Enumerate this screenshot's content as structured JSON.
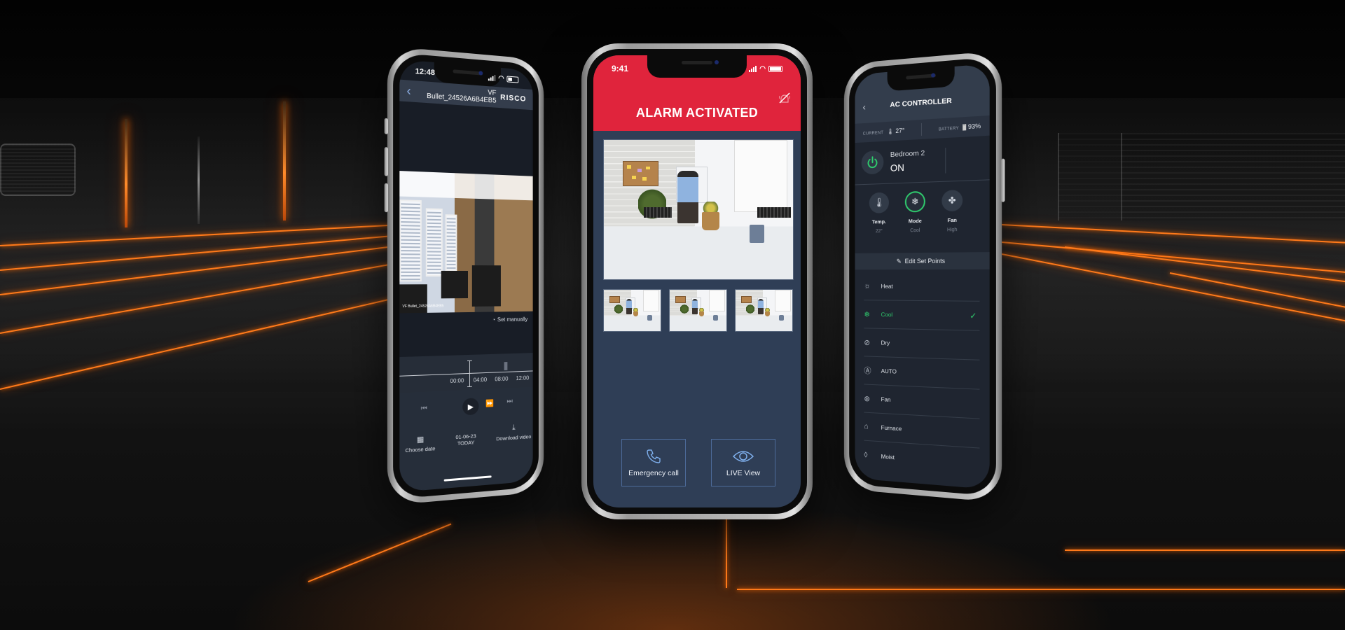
{
  "left_phone": {
    "status_time": "12:48",
    "header": {
      "back_icon": "chevron-left-icon",
      "title": "VF Bullet_24526A6B4EB5",
      "brand": "RISCO"
    },
    "video": {
      "camera_label": "VF Bullet_24526A6B4EB5"
    },
    "set_manually": "Set manually",
    "timeline": {
      "ticks": [
        "00:00",
        "04:00",
        "08:00",
        "12:00"
      ]
    },
    "playback": {
      "prev_icon": "skip-back-icon",
      "play_icon": "play-icon",
      "fast_forward_icon": "fast-forward-icon",
      "next_icon": "skip-forward-icon"
    },
    "bottom": {
      "choose_date": "Choose date",
      "date": "01-06-23",
      "today": "TODAY",
      "download": "Download video"
    }
  },
  "center_phone": {
    "status_time": "9:41",
    "title": "ALARM ACTIVATED",
    "siren_icon": "siren-off-icon",
    "buttons": {
      "emergency_call": "Emergency call",
      "live_view": "LIVE View"
    },
    "colors": {
      "header": "#e0243c",
      "body": "#2f3e56",
      "button_border": "#4d6b9a"
    }
  },
  "right_phone": {
    "header": {
      "title": "AC CONTROLLER"
    },
    "stats": {
      "current_label": "CURRENT",
      "current_value": "27°",
      "battery_label": "BATTERY",
      "battery_value": "93%"
    },
    "device": {
      "name": "Bedroom 2",
      "state": "ON"
    },
    "modes": [
      {
        "label": "Temp.",
        "value": "22°"
      },
      {
        "label": "Mode",
        "value": "Cool"
      },
      {
        "label": "Fan",
        "value": "High"
      }
    ],
    "edit_set_points": "Edit Set Points",
    "mode_list": [
      {
        "label": "Heat",
        "icon": "sun-icon"
      },
      {
        "label": "Cool",
        "icon": "snowflake-icon",
        "selected": true
      },
      {
        "label": "Dry",
        "icon": "drop-slash-icon"
      },
      {
        "label": "AUTO",
        "icon": "auto-icon"
      },
      {
        "label": "Fan",
        "icon": "fan-icon"
      },
      {
        "label": "Furnace",
        "icon": "furnace-icon"
      },
      {
        "label": "Moist",
        "icon": "drop-icon"
      }
    ],
    "colors": {
      "accent": "#2fcd6e",
      "background": "#1f2530"
    }
  }
}
